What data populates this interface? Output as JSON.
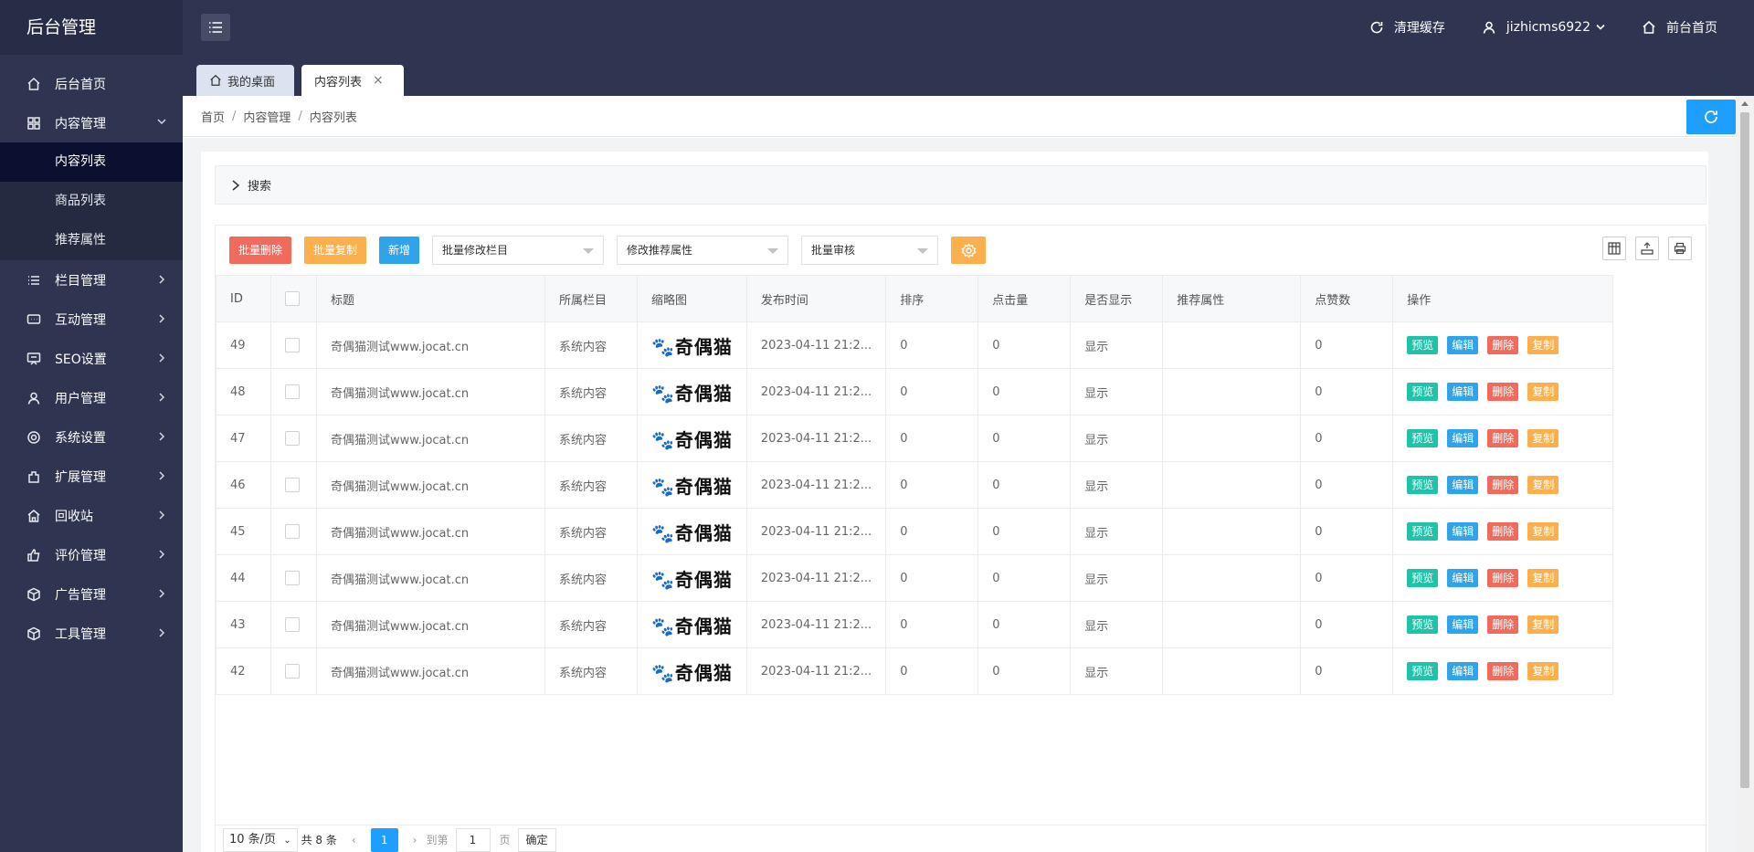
{
  "brand": "后台管理",
  "header": {
    "clear_cache": "清理缓存",
    "username": "jizhicms6922",
    "front_home": "前台首页"
  },
  "sidebar": {
    "items": [
      {
        "label": "后台首页",
        "icon": "home-icon"
      },
      {
        "label": "内容管理",
        "icon": "grid-icon",
        "expanded": true,
        "children": [
          "内容列表",
          "商品列表",
          "推荐属性"
        ],
        "active_child": "内容列表"
      },
      {
        "label": "栏目管理",
        "icon": "list-icon"
      },
      {
        "label": "互动管理",
        "icon": "chat-icon"
      },
      {
        "label": "SEO设置",
        "icon": "seo-icon"
      },
      {
        "label": "用户管理",
        "icon": "user-icon"
      },
      {
        "label": "系统设置",
        "icon": "gear-icon"
      },
      {
        "label": "扩展管理",
        "icon": "extension-icon"
      },
      {
        "label": "回收站",
        "icon": "recycle-icon"
      },
      {
        "label": "评价管理",
        "icon": "thumbs-up-icon"
      },
      {
        "label": "广告管理",
        "icon": "box-icon"
      },
      {
        "label": "工具管理",
        "icon": "cube-icon"
      }
    ]
  },
  "tabs": {
    "home": "我的桌面",
    "content": "内容列表",
    "close": "×"
  },
  "breadcrumb": [
    "首页",
    "内容管理",
    "内容列表"
  ],
  "breadcrumb_sep": "/",
  "search": {
    "label": "搜索"
  },
  "toolbar": {
    "batch_delete": "批量删除",
    "batch_copy": "批量复制",
    "add_new": "新增",
    "select_column": "批量修改栏目",
    "select_recommend": "修改推荐属性",
    "select_review": "批量审核"
  },
  "table": {
    "columns": [
      "ID",
      "",
      "标题",
      "所属栏目",
      "缩略图",
      "发布时间",
      "排序",
      "点击量",
      "是否显示",
      "推荐属性",
      "点赞数",
      "操作"
    ],
    "rows": [
      {
        "id": "49",
        "title": "奇偶猫测试www.jocat.cn",
        "category": "系统内容",
        "thumb": "🐾奇偶猫",
        "time": "2023-04-11 21:2...",
        "sort": "0",
        "clicks": "0",
        "show": "显示",
        "recommend": "",
        "likes": "0"
      },
      {
        "id": "48",
        "title": "奇偶猫测试www.jocat.cn",
        "category": "系统内容",
        "thumb": "🐾奇偶猫",
        "time": "2023-04-11 21:2...",
        "sort": "0",
        "clicks": "0",
        "show": "显示",
        "recommend": "",
        "likes": "0"
      },
      {
        "id": "47",
        "title": "奇偶猫测试www.jocat.cn",
        "category": "系统内容",
        "thumb": "🐾奇偶猫",
        "time": "2023-04-11 21:2...",
        "sort": "0",
        "clicks": "0",
        "show": "显示",
        "recommend": "",
        "likes": "0"
      },
      {
        "id": "46",
        "title": "奇偶猫测试www.jocat.cn",
        "category": "系统内容",
        "thumb": "🐾奇偶猫",
        "time": "2023-04-11 21:2...",
        "sort": "0",
        "clicks": "0",
        "show": "显示",
        "recommend": "",
        "likes": "0"
      },
      {
        "id": "45",
        "title": "奇偶猫测试www.jocat.cn",
        "category": "系统内容",
        "thumb": "🐾奇偶猫",
        "time": "2023-04-11 21:2...",
        "sort": "0",
        "clicks": "0",
        "show": "显示",
        "recommend": "",
        "likes": "0"
      },
      {
        "id": "44",
        "title": "奇偶猫测试www.jocat.cn",
        "category": "系统内容",
        "thumb": "🐾奇偶猫",
        "time": "2023-04-11 21:2...",
        "sort": "0",
        "clicks": "0",
        "show": "显示",
        "recommend": "",
        "likes": "0"
      },
      {
        "id": "43",
        "title": "奇偶猫测试www.jocat.cn",
        "category": "系统内容",
        "thumb": "🐾奇偶猫",
        "time": "2023-04-11 21:2...",
        "sort": "0",
        "clicks": "0",
        "show": "显示",
        "recommend": "",
        "likes": "0"
      },
      {
        "id": "42",
        "title": "奇偶猫测试www.jocat.cn",
        "category": "系统内容",
        "thumb": "🐾奇偶猫",
        "time": "2023-04-11 21:2...",
        "sort": "0",
        "clicks": "0",
        "show": "显示",
        "recommend": "",
        "likes": "0"
      }
    ],
    "actions": [
      "预览",
      "编辑",
      "删除",
      "复制"
    ]
  },
  "pager": {
    "page_size": "10 条/页",
    "total": "共 8 条",
    "current": "1",
    "goto_label": "到第",
    "goto_value": "1",
    "page_unit": "页",
    "confirm": "确定"
  },
  "colors": {
    "sidebar_bg": "#2f3450",
    "active_bg": "#0c1030",
    "primary": "#1e9fff",
    "danger": "#f16b5c",
    "warning": "#fcb04d",
    "success": "#1fc4a8"
  }
}
